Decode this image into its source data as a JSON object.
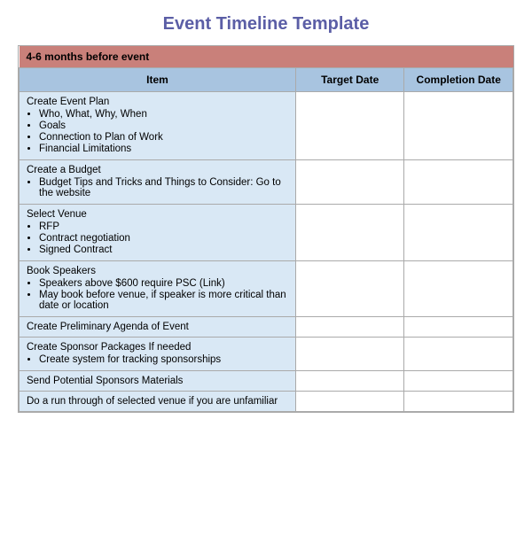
{
  "title": "Event Timeline Template",
  "section": {
    "label": "4-6 months before event"
  },
  "headers": {
    "item": "Item",
    "target_date": "Target Date",
    "completion_date": "Completion Date"
  },
  "rows": [
    {
      "title": "Create Event Plan",
      "bullets": [
        "Who, What, Why, When",
        "Goals",
        "Connection to Plan of Work",
        "Financial Limitations"
      ]
    },
    {
      "title": "Create a Budget",
      "bullets": [
        "Budget Tips and Tricks and Things to Consider: Go to the website"
      ]
    },
    {
      "title": "Select Venue",
      "bullets": [
        "RFP",
        "Contract negotiation",
        "Signed Contract"
      ]
    },
    {
      "title": "Book Speakers",
      "bullets": [
        "Speakers above $600 require PSC (Link)",
        "May book before venue, if speaker is more critical than date or location"
      ]
    },
    {
      "title": "Create Preliminary Agenda of Event",
      "bullets": []
    },
    {
      "title": "Create Sponsor Packages If needed",
      "bullets": [
        "Create system for tracking sponsorships"
      ]
    },
    {
      "title": "Send Potential Sponsors Materials",
      "bullets": []
    },
    {
      "title": "Do a run through of selected venue if you are unfamiliar",
      "bullets": []
    }
  ]
}
